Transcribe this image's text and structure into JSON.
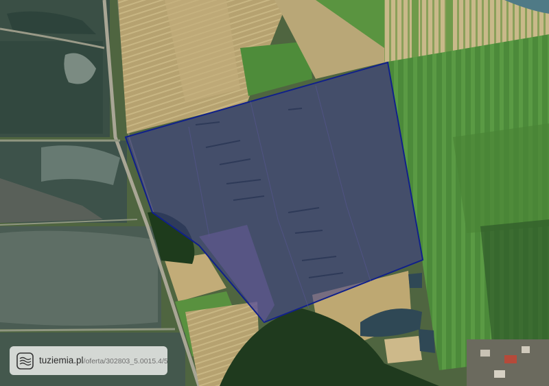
{
  "map": {
    "view": "satellite",
    "overlay_fill": "#3c3c8c",
    "overlay_stroke": "#10208a",
    "road_color": "#a9a695"
  },
  "watermark": {
    "logo": "tuziemia-logo-icon",
    "brand": "tuziemia.pl",
    "path": "/oferta/302803_5.0015.4/5"
  }
}
